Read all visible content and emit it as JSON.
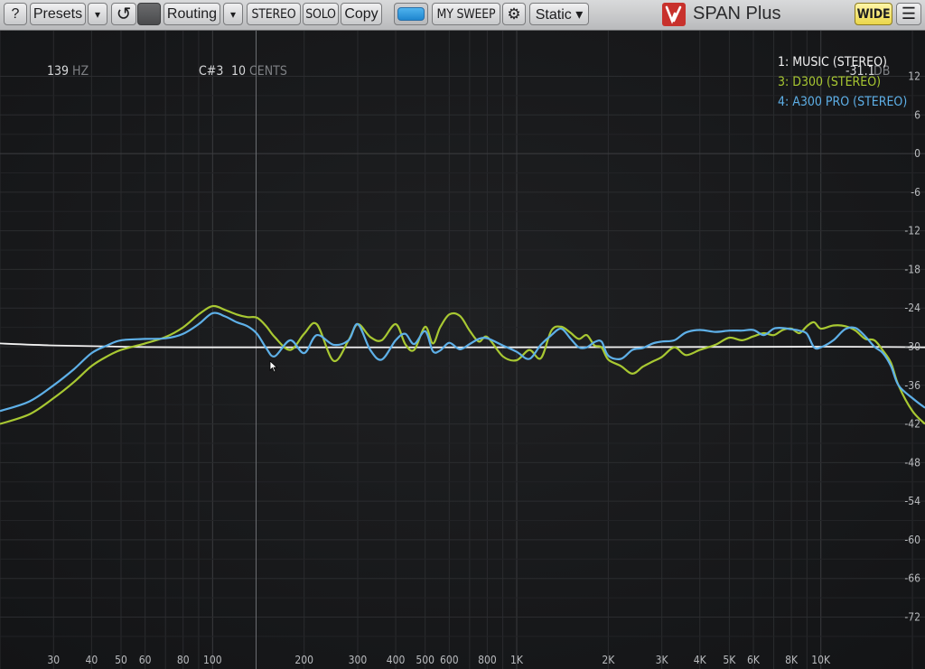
{
  "toolbar": {
    "help_label": "?",
    "presets_label": "Presets",
    "dropdown_glyph": "▾",
    "reset_glyph": "↺",
    "routing_label": "Routing",
    "stereo_label": "STEREO",
    "solo_label": "SOLO",
    "copy_label": "Copy",
    "sweep_label": "MY SWEEP",
    "settings_glyph": "⚙",
    "mode_label": "Static ▾",
    "logo_icon": "span-logo-icon",
    "app_title": "SPAN Plus",
    "wide_label": "WIDE",
    "menu_glyph": "☰"
  },
  "readout": {
    "freq_value": "139",
    "freq_unit": "HZ",
    "note_value": "C#3",
    "cents_value": "10",
    "cents_unit": "CENTS",
    "db_value": "-31.1",
    "db_unit": "DB"
  },
  "legend": [
    {
      "label": "1: MUSIC (STEREO)",
      "color": "#f2f2f2"
    },
    {
      "label": "3: D300 (STEREO)",
      "color": "#a8c832"
    },
    {
      "label": "4: A300 PRO (STEREO)",
      "color": "#5eb0e8"
    }
  ],
  "chart_data": {
    "type": "line",
    "x_scale": "log",
    "xlim": [
      20,
      22000
    ],
    "ylim": [
      -76,
      16
    ],
    "x_ticks": [
      {
        "v": 30,
        "t": "30"
      },
      {
        "v": 40,
        "t": "40"
      },
      {
        "v": 50,
        "t": "50"
      },
      {
        "v": 60,
        "t": "60"
      },
      {
        "v": 80,
        "t": "80"
      },
      {
        "v": 100,
        "t": "100"
      },
      {
        "v": 200,
        "t": "200"
      },
      {
        "v": 300,
        "t": "300"
      },
      {
        "v": 400,
        "t": "400"
      },
      {
        "v": 500,
        "t": "500"
      },
      {
        "v": 600,
        "t": "600"
      },
      {
        "v": 800,
        "t": "800"
      },
      {
        "v": 1000,
        "t": "1K"
      },
      {
        "v": 2000,
        "t": "2K"
      },
      {
        "v": 3000,
        "t": "3K"
      },
      {
        "v": 4000,
        "t": "4K"
      },
      {
        "v": 5000,
        "t": "5K"
      },
      {
        "v": 6000,
        "t": "6K"
      },
      {
        "v": 8000,
        "t": "8K"
      },
      {
        "v": 10000,
        "t": "10K"
      }
    ],
    "y_ticks": [
      {
        "v": 12,
        "t": "12"
      },
      {
        "v": 6,
        "t": "6"
      },
      {
        "v": 0,
        "t": "0"
      },
      {
        "v": -6,
        "t": "-6"
      },
      {
        "v": -12,
        "t": "-12"
      },
      {
        "v": -18,
        "t": "-18"
      },
      {
        "v": -24,
        "t": "-24"
      },
      {
        "v": -30,
        "t": "-30"
      },
      {
        "v": -36,
        "t": "-36"
      },
      {
        "v": -42,
        "t": "-42"
      },
      {
        "v": -48,
        "t": "-48"
      },
      {
        "v": -54,
        "t": "-54"
      },
      {
        "v": -60,
        "t": "-60"
      },
      {
        "v": -66,
        "t": "-66"
      },
      {
        "v": -72,
        "t": "-72"
      }
    ],
    "cursor_freq": 139,
    "series": [
      {
        "name": "1: MUSIC (STEREO)",
        "color": "#f2f2f2",
        "x": [
          20,
          30,
          50,
          100,
          1000,
          10000,
          22000
        ],
        "y": [
          -29.5,
          -29.8,
          -30,
          -30.1,
          -30.1,
          -30,
          -30.1
        ]
      },
      {
        "name": "3: D300 (STEREO)",
        "color": "#a8c832",
        "x": [
          20,
          25,
          30,
          35,
          40,
          45,
          50,
          60,
          70,
          80,
          90,
          100,
          110,
          120,
          130,
          140,
          150,
          160,
          180,
          200,
          220,
          250,
          280,
          300,
          330,
          360,
          400,
          430,
          460,
          500,
          530,
          560,
          600,
          650,
          700,
          750,
          800,
          900,
          1000,
          1100,
          1200,
          1300,
          1400,
          1500,
          1600,
          1700,
          1800,
          1900,
          2000,
          2200,
          2400,
          2600,
          2800,
          3000,
          3300,
          3600,
          4000,
          4500,
          5000,
          5500,
          6000,
          6500,
          7000,
          7500,
          8000,
          8500,
          9000,
          9500,
          10000,
          11000,
          12000,
          13000,
          14000,
          15000,
          16000,
          17000,
          18000,
          20000,
          22000
        ],
        "y": [
          -42,
          -40.5,
          -38,
          -35.5,
          -33,
          -31.5,
          -30.5,
          -29.5,
          -28.5,
          -27,
          -25,
          -23.7,
          -24.3,
          -25,
          -25.4,
          -25.5,
          -26.8,
          -28.5,
          -30.5,
          -28,
          -26.5,
          -32.2,
          -29,
          -26.5,
          -28.5,
          -29,
          -26.5,
          -29.6,
          -30.5,
          -26.9,
          -29.5,
          -27,
          -25,
          -25.2,
          -27.5,
          -29.2,
          -28.5,
          -31.5,
          -32.1,
          -30.5,
          -31.8,
          -27.5,
          -26.9,
          -27.8,
          -28.8,
          -28.2,
          -29.8,
          -30.1,
          -32,
          -33,
          -34.2,
          -33.1,
          -32.3,
          -31.6,
          -30.1,
          -31.3,
          -30.5,
          -29.7,
          -28.6,
          -29,
          -28.4,
          -27.9,
          -28.2,
          -27.4,
          -27.2,
          -27.9,
          -26.8,
          -26.2,
          -27.2,
          -26.7,
          -26.8,
          -27.5,
          -28.8,
          -29,
          -30.6,
          -32.5,
          -36,
          -40,
          -42
        ]
      },
      {
        "name": "4: A300 PRO (STEREO)",
        "color": "#5eb0e8",
        "x": [
          20,
          25,
          30,
          35,
          40,
          45,
          50,
          60,
          70,
          80,
          90,
          100,
          110,
          120,
          130,
          140,
          150,
          160,
          180,
          200,
          220,
          250,
          280,
          300,
          330,
          360,
          400,
          430,
          460,
          500,
          530,
          560,
          600,
          650,
          700,
          750,
          800,
          900,
          1000,
          1100,
          1200,
          1300,
          1400,
          1500,
          1600,
          1700,
          1800,
          1900,
          2000,
          2200,
          2400,
          2600,
          2800,
          3000,
          3300,
          3600,
          4000,
          4500,
          5000,
          5500,
          6000,
          6500,
          7000,
          7500,
          8000,
          8500,
          9000,
          9500,
          10000,
          11000,
          12000,
          13000,
          14000,
          15000,
          16000,
          17000,
          18000,
          20000,
          22000
        ],
        "y": [
          -40,
          -38.5,
          -36,
          -33.5,
          -31,
          -29.8,
          -29,
          -28.8,
          -28.7,
          -28,
          -26.5,
          -24.8,
          -25.3,
          -26.2,
          -26.8,
          -28,
          -30.2,
          -31.5,
          -29,
          -31,
          -28.2,
          -29.7,
          -29,
          -26.5,
          -30.5,
          -32,
          -29,
          -28,
          -29.6,
          -27.6,
          -30.7,
          -30.6,
          -29.4,
          -30.4,
          -29.6,
          -28.8,
          -28.7,
          -29.8,
          -30.8,
          -31.9,
          -29.7,
          -28.2,
          -27.2,
          -28.7,
          -30.1,
          -30.1,
          -29.3,
          -29.2,
          -31.4,
          -31.9,
          -30.5,
          -30.2,
          -29.5,
          -29.2,
          -29,
          -27.8,
          -27.4,
          -27.7,
          -27.5,
          -27.5,
          -27.4,
          -28.2,
          -27.2,
          -27.1,
          -27.3,
          -27.5,
          -28,
          -30.1,
          -30.1,
          -29,
          -27.3,
          -27.1,
          -28.4,
          -30,
          -31,
          -33,
          -36,
          -38,
          -39.5
        ]
      }
    ]
  }
}
